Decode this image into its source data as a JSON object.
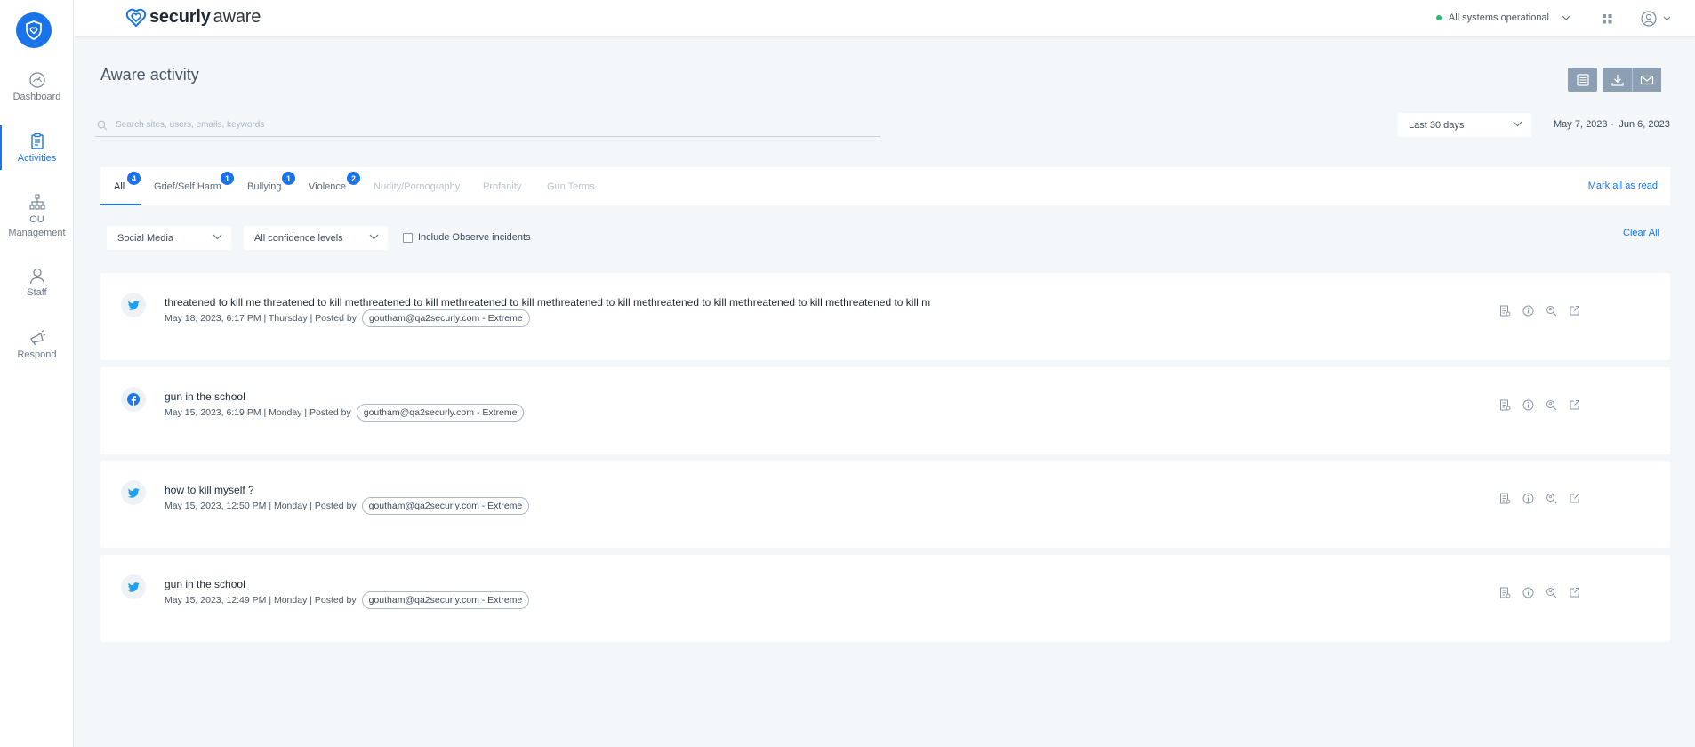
{
  "colors": {
    "accent": "#1a73e8",
    "status_ok": "#20c070",
    "action_button": "#8c9fb3",
    "twitter": "#1da1f2",
    "facebook": "#1877f2"
  },
  "sidebar": {
    "logo_icon": "shield-heart-icon",
    "items": [
      {
        "label": "Dashboard",
        "icon": "gauge-icon"
      },
      {
        "label": "Activities",
        "icon": "clipboard-icon",
        "active": true
      },
      {
        "label": "OU\nManagement",
        "icon": "org-chart-icon"
      },
      {
        "label": "Staff",
        "icon": "person-icon"
      },
      {
        "label": "Respond",
        "icon": "megaphone-icon"
      }
    ]
  },
  "header": {
    "brand_part1": "securly",
    "brand_part2": "aware",
    "status_text": "All systems operational",
    "apps_icon": "grid-icon",
    "user_icon": "user-circle-icon"
  },
  "page": {
    "title": "Aware activity",
    "actions": {
      "report": "report-icon",
      "download": "download-icon",
      "email": "mail-icon"
    }
  },
  "search": {
    "placeholder": "Search sites, users, emails, keywords"
  },
  "date_filter": {
    "selected": "Last 30 days",
    "range": "May 7, 2023 -  Jun 6, 2023"
  },
  "tabs": [
    {
      "label": "All",
      "badge": "4",
      "active": true
    },
    {
      "label": "Grief/Self Harm",
      "badge": "1"
    },
    {
      "label": "Bullying",
      "badge": "1"
    },
    {
      "label": "Violence",
      "badge": "2"
    },
    {
      "label": "Nudity/Pornography",
      "disabled": true
    },
    {
      "label": "Profanity",
      "disabled": true
    },
    {
      "label": "Gun Terms",
      "disabled": true
    }
  ],
  "mark_all_read": "Mark all as read",
  "filters": {
    "source": "Social Media",
    "confidence": "All confidence levels",
    "observe_label": "Include Observe incidents",
    "clear_all": "Clear All"
  },
  "incidents": [
    {
      "source_icon": "twitter-icon",
      "text": "threatened to kill me threatened to kill methreatened to kill methreatened to kill methreatened to kill methreatened to kill methreatened to kill methreatened to kill m",
      "meta": "May 18, 2023, 6:17 PM | Thursday | Posted by",
      "user": "goutham@qa2securly.com - Extreme"
    },
    {
      "source_icon": "facebook-icon",
      "text": "gun in the school",
      "meta": "May 15, 2023, 6:19 PM | Monday | Posted by",
      "user": "goutham@qa2securly.com - Extreme"
    },
    {
      "source_icon": "twitter-icon",
      "text": "how to kill myself ?",
      "meta": "May 15, 2023, 12:50 PM | Monday | Posted by",
      "user": "goutham@qa2securly.com - Extreme"
    },
    {
      "source_icon": "twitter-icon",
      "text": "gun in the school",
      "meta": "May 15, 2023, 12:49 PM | Monday | Posted by",
      "user": "goutham@qa2securly.com - Extreme"
    }
  ]
}
